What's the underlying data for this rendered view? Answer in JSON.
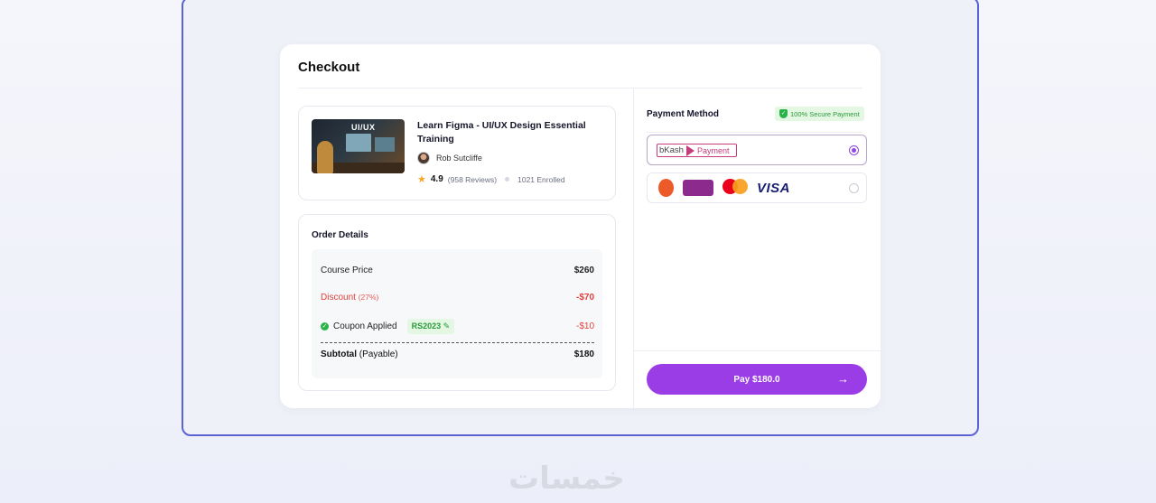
{
  "checkout": {
    "title": "Checkout"
  },
  "course": {
    "thumbnail_text": "UI/UX",
    "title": "Learn Figma - UI/UX Design Essential Training",
    "author": "Rob Sutcliffe",
    "rating": "4.9",
    "reviews": "(958 Reviews)",
    "enrolled": "1021 Enrolled"
  },
  "order": {
    "title": "Order Details",
    "course_price_label": "Course Price",
    "course_price_value": "$260",
    "discount_label": "Discount",
    "discount_pct": "(27%)",
    "discount_value": "-$70",
    "coupon_label": "Coupon Applied",
    "coupon_code": "RS2023",
    "coupon_value": "-$10",
    "subtotal_label": "Subtotal",
    "subtotal_qualifier": "(Payable)",
    "subtotal_value": "$180"
  },
  "payment": {
    "title": "Payment Method",
    "secure_badge": "100% Secure Payment",
    "options": [
      {
        "brand_b": "bKash",
        "brand_suffix": "Payment",
        "selected": true
      },
      {
        "logos": [
          "nagad-logo",
          "rocket-logo",
          "mastercard-logo",
          "visa-logo"
        ],
        "visa_text": "VISA",
        "selected": false
      }
    ],
    "pay_button": "Pay $180.0"
  },
  "watermark": "خمسات",
  "colors": {
    "accent": "#9b3de6",
    "danger": "#e0413b",
    "success": "#2bb34a",
    "frame": "#5b63d3"
  }
}
